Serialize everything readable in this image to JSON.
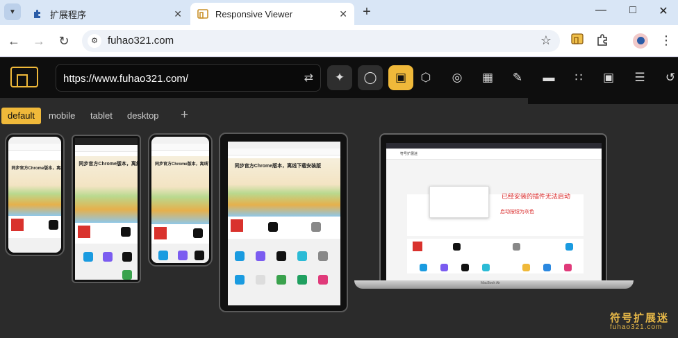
{
  "browser": {
    "tabs": [
      {
        "label": "扩展程序"
      },
      {
        "label": "Responsive Viewer"
      }
    ],
    "address": "fuhao321.com"
  },
  "app": {
    "url_value": "https://www.fuhao321.com/",
    "view_tabs": [
      "default",
      "mobile",
      "tablet",
      "desktop"
    ],
    "add_label": "+"
  },
  "page_preview": {
    "headline": "同步官方Chrome版本，离线下载安装版",
    "site_name": "符号扩展迷",
    "callout_1": "已经安装的插件无法启动",
    "callout_2": "启动按钮为灰色",
    "laptop_label": "MacBook Air"
  },
  "watermark": {
    "line1": "符号扩展迷",
    "line2": "fuhao321.com"
  },
  "colors": {
    "accent": "#f0b93a",
    "app_bg": "#0e0e0e",
    "chrome_tabstrip": "#d9e6f6"
  }
}
